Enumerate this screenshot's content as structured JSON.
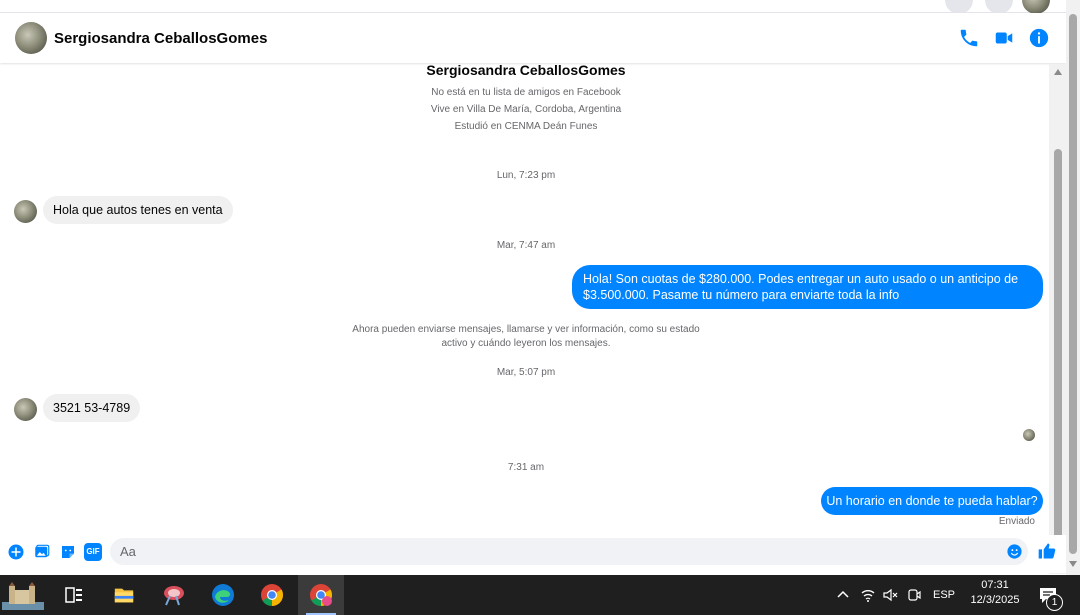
{
  "header": {
    "contact_name": "Sergiosandra CeballosGomes"
  },
  "profile": {
    "name": "Sergiosandra CeballosGomes",
    "lines": [
      "No está en tu lista de amigos en Facebook",
      "Vive en Villa De María, Cordoba, Argentina",
      "Estudió en CENMA Deán Funes"
    ]
  },
  "messages": {
    "ts1": "Lun, 7:23 pm",
    "in1": "Hola que autos tenes en venta",
    "ts2": "Mar, 7:47 am",
    "out1_line1": "Hola! Son cuotas de $280.000. Podes entregar un auto usado o un anticipo de",
    "out1_line2": "$3.500.000. Pasame tu número para enviarte toda la info",
    "system_line1": "Ahora pueden enviarse mensajes, llamarse y ver información, como su estado",
    "system_line2": "activo y cuándo leyeron los mensajes.",
    "ts3": "Mar, 5:07 pm",
    "in2": "3521 53-4789",
    "ts4": "7:31 am",
    "out2": "Un horario en donde te pueda hablar?",
    "status": "Enviado"
  },
  "composer": {
    "placeholder": "Aa",
    "gif_label": "GIF"
  },
  "taskbar": {
    "language": "ESP",
    "time": "07:31",
    "date": "12/3/2025",
    "notification_count": "1"
  },
  "colors": {
    "accent": "#0084ff",
    "bubble_in": "#f0f0f0"
  }
}
